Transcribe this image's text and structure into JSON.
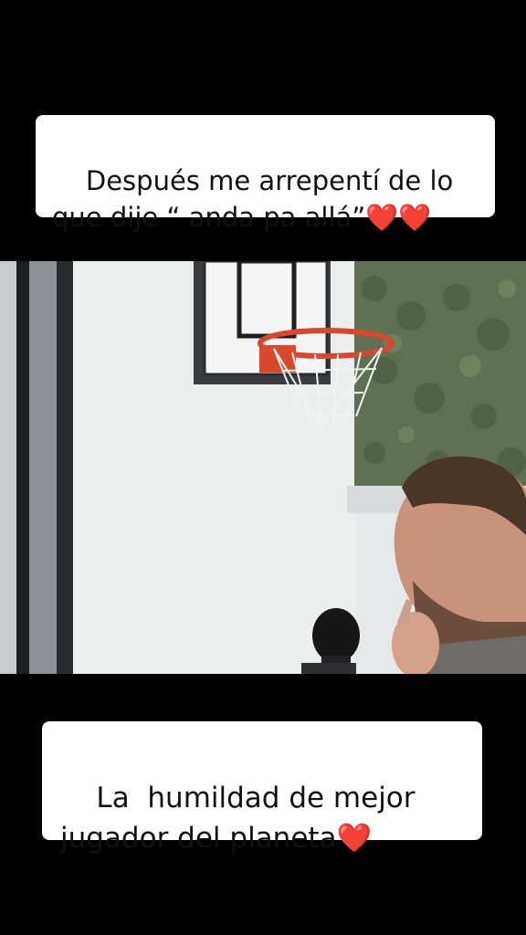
{
  "captions": {
    "top": {
      "text": "Después me arrepentí de lo que dije “ anda pa allá”",
      "emoji": "❤️❤️"
    },
    "bottom": {
      "text": "La  humildad de mejor jugador del planeta",
      "emoji": "❤️"
    }
  },
  "colors": {
    "background": "#000000",
    "caption_bg": "#ffffff",
    "caption_text": "#111111",
    "heart": "#e8142b"
  },
  "scene": {
    "objects": [
      "basketball-hoop",
      "hedge-wall",
      "window-frame",
      "man-with-beard",
      "microphone"
    ]
  }
}
